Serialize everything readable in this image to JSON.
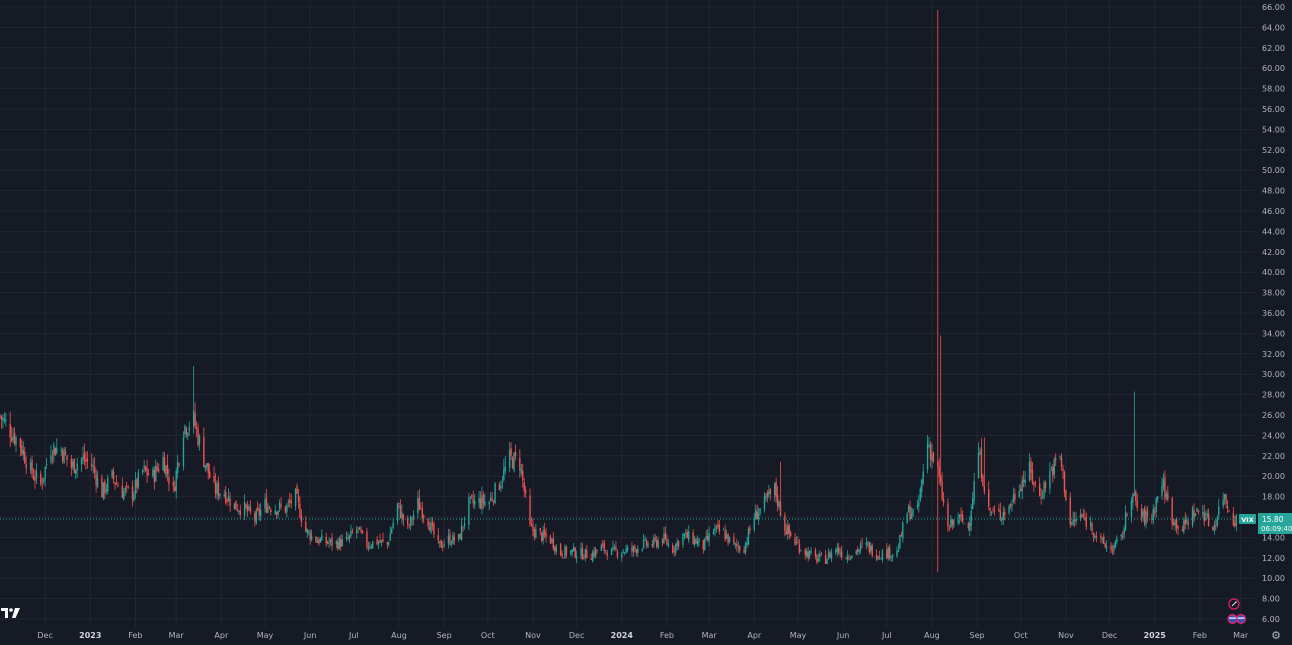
{
  "symbol": "VIX",
  "price_label": "15.80",
  "countdown": "06:09:40",
  "colors": {
    "background": "#161a25",
    "grid": "#232733",
    "up": "#26a69a",
    "down": "#ef5350",
    "price_line": "#26a69a",
    "axis_text": "#b2b5be"
  },
  "icons": {
    "logo": "tradingview-logo-icon",
    "settings": "gear-icon",
    "events": "event-flags-icon"
  },
  "chart_data": {
    "type": "candlestick",
    "y_axis": {
      "min": 5,
      "max": 66,
      "ticks": [
        "6.00",
        "8.00",
        "10.00",
        "12.00",
        "14.00",
        "16.00",
        "18.00",
        "20.00",
        "22.00",
        "24.00",
        "26.00",
        "28.00",
        "30.00",
        "32.00",
        "34.00",
        "36.00",
        "38.00",
        "40.00",
        "42.00",
        "44.00",
        "46.00",
        "48.00",
        "50.00",
        "52.00",
        "54.00",
        "56.00",
        "58.00",
        "60.00",
        "62.00",
        "64.00",
        "66.00"
      ]
    },
    "x_axis": {
      "start": "2022-10-31",
      "end": "2025-03-04",
      "ticks": [
        {
          "label": "Dec",
          "date": "2022-12-01"
        },
        {
          "label": "2023",
          "date": "2023-01-01",
          "bold": true
        },
        {
          "label": "Feb",
          "date": "2023-02-01"
        },
        {
          "label": "Mar",
          "date": "2023-03-01"
        },
        {
          "label": "Apr",
          "date": "2023-04-01"
        },
        {
          "label": "May",
          "date": "2023-05-01"
        },
        {
          "label": "Jun",
          "date": "2023-06-01"
        },
        {
          "label": "Jul",
          "date": "2023-07-01"
        },
        {
          "label": "Aug",
          "date": "2023-08-01"
        },
        {
          "label": "Sep",
          "date": "2023-09-01"
        },
        {
          "label": "Oct",
          "date": "2023-10-01"
        },
        {
          "label": "Nov",
          "date": "2023-11-01"
        },
        {
          "label": "Dec",
          "date": "2023-12-01"
        },
        {
          "label": "2024",
          "date": "2024-01-01",
          "bold": true
        },
        {
          "label": "Feb",
          "date": "2024-02-01"
        },
        {
          "label": "Mar",
          "date": "2024-03-01"
        },
        {
          "label": "Apr",
          "date": "2024-04-01"
        },
        {
          "label": "May",
          "date": "2024-05-01"
        },
        {
          "label": "Jun",
          "date": "2024-06-01"
        },
        {
          "label": "Jul",
          "date": "2024-07-01"
        },
        {
          "label": "Aug",
          "date": "2024-08-01"
        },
        {
          "label": "Sep",
          "date": "2024-09-01"
        },
        {
          "label": "Oct",
          "date": "2024-10-01"
        },
        {
          "label": "Nov",
          "date": "2024-11-01"
        },
        {
          "label": "Dec",
          "date": "2024-12-01"
        },
        {
          "label": "2025",
          "date": "2025-01-01",
          "bold": true
        },
        {
          "label": "Feb",
          "date": "2025-02-01"
        },
        {
          "label": "Mar",
          "date": "2025-03-01"
        }
      ]
    },
    "last_price": 15.8,
    "close_path": [
      [
        "2022-10-31",
        25.9
      ],
      [
        "2022-11-07",
        24.5
      ],
      [
        "2022-11-14",
        23.1
      ],
      [
        "2022-11-21",
        20.5
      ],
      [
        "2022-11-28",
        19.2
      ],
      [
        "2022-12-05",
        22.8
      ],
      [
        "2022-12-12",
        22.6
      ],
      [
        "2022-12-19",
        20.9
      ],
      [
        "2022-12-26",
        21.7
      ],
      [
        "2023-01-02",
        21.1
      ],
      [
        "2023-01-09",
        18.4
      ],
      [
        "2023-01-16",
        19.9
      ],
      [
        "2023-01-23",
        18.5
      ],
      [
        "2023-01-30",
        18.3
      ],
      [
        "2023-02-06",
        20.5
      ],
      [
        "2023-02-13",
        20.0
      ],
      [
        "2023-02-20",
        21.7
      ],
      [
        "2023-02-27",
        18.5
      ],
      [
        "2023-03-06",
        24.8
      ],
      [
        "2023-03-13",
        25.5
      ],
      [
        "2023-03-20",
        21.7
      ],
      [
        "2023-03-27",
        18.7
      ],
      [
        "2023-04-03",
        18.4
      ],
      [
        "2023-04-10",
        17.1
      ],
      [
        "2023-04-17",
        16.8
      ],
      [
        "2023-04-24",
        15.8
      ],
      [
        "2023-05-01",
        17.2
      ],
      [
        "2023-05-08",
        16.9
      ],
      [
        "2023-05-15",
        16.8
      ],
      [
        "2023-05-22",
        18.0
      ],
      [
        "2023-05-29",
        14.6
      ],
      [
        "2023-06-05",
        13.8
      ],
      [
        "2023-06-12",
        13.5
      ],
      [
        "2023-06-19",
        13.4
      ],
      [
        "2023-06-26",
        13.6
      ],
      [
        "2023-07-03",
        14.8
      ],
      [
        "2023-07-10",
        13.3
      ],
      [
        "2023-07-17",
        13.6
      ],
      [
        "2023-07-24",
        13.3
      ],
      [
        "2023-07-31",
        17.1
      ],
      [
        "2023-08-07",
        14.8
      ],
      [
        "2023-08-14",
        17.3
      ],
      [
        "2023-08-21",
        15.7
      ],
      [
        "2023-08-28",
        13.1
      ],
      [
        "2023-09-04",
        13.8
      ],
      [
        "2023-09-11",
        13.8
      ],
      [
        "2023-09-18",
        17.2
      ],
      [
        "2023-09-25",
        17.5
      ],
      [
        "2023-10-02",
        17.5
      ],
      [
        "2023-10-09",
        19.3
      ],
      [
        "2023-10-16",
        21.7
      ],
      [
        "2023-10-23",
        21.3
      ],
      [
        "2023-10-30",
        14.9
      ],
      [
        "2023-11-06",
        14.2
      ],
      [
        "2023-11-13",
        13.8
      ],
      [
        "2023-11-20",
        12.5
      ],
      [
        "2023-11-27",
        12.6
      ],
      [
        "2023-12-04",
        12.4
      ],
      [
        "2023-12-11",
        12.3
      ],
      [
        "2023-12-18",
        13.0
      ],
      [
        "2023-12-25",
        12.5
      ],
      [
        "2024-01-01",
        12.7
      ],
      [
        "2024-01-08",
        12.7
      ],
      [
        "2024-01-15",
        13.3
      ],
      [
        "2024-01-22",
        13.3
      ],
      [
        "2024-01-29",
        13.9
      ],
      [
        "2024-02-05",
        12.9
      ],
      [
        "2024-02-12",
        14.2
      ],
      [
        "2024-02-19",
        13.8
      ],
      [
        "2024-02-26",
        13.1
      ],
      [
        "2024-03-04",
        14.7
      ],
      [
        "2024-03-11",
        14.4
      ],
      [
        "2024-03-18",
        13.1
      ],
      [
        "2024-03-25",
        13.0
      ],
      [
        "2024-04-01",
        16.0
      ],
      [
        "2024-04-08",
        17.3
      ],
      [
        "2024-04-15",
        18.7
      ],
      [
        "2024-04-22",
        15.0
      ],
      [
        "2024-04-29",
        13.5
      ],
      [
        "2024-05-06",
        12.6
      ],
      [
        "2024-05-13",
        11.9
      ],
      [
        "2024-05-20",
        11.9
      ],
      [
        "2024-05-27",
        12.9
      ],
      [
        "2024-06-03",
        12.2
      ],
      [
        "2024-06-10",
        12.7
      ],
      [
        "2024-06-17",
        13.2
      ],
      [
        "2024-06-24",
        12.4
      ],
      [
        "2024-07-01",
        12.5
      ],
      [
        "2024-07-08",
        12.5
      ],
      [
        "2024-07-15",
        16.5
      ],
      [
        "2024-07-22",
        16.4
      ],
      [
        "2024-07-29",
        23.4
      ],
      [
        "2024-08-05",
        20.4
      ],
      [
        "2024-08-12",
        14.8
      ],
      [
        "2024-08-19",
        15.9
      ],
      [
        "2024-08-26",
        15.0
      ],
      [
        "2024-09-02",
        22.4
      ],
      [
        "2024-09-09",
        16.6
      ],
      [
        "2024-09-16",
        16.2
      ],
      [
        "2024-09-23",
        16.9
      ],
      [
        "2024-09-30",
        19.2
      ],
      [
        "2024-10-07",
        20.5
      ],
      [
        "2024-10-14",
        18.0
      ],
      [
        "2024-10-21",
        20.3
      ],
      [
        "2024-10-28",
        21.9
      ],
      [
        "2024-11-04",
        15.2
      ],
      [
        "2024-11-11",
        16.1
      ],
      [
        "2024-11-18",
        15.2
      ],
      [
        "2024-11-25",
        13.5
      ],
      [
        "2024-12-02",
        12.8
      ],
      [
        "2024-12-09",
        13.8
      ],
      [
        "2024-12-16",
        18.4
      ],
      [
        "2024-12-23",
        15.9
      ],
      [
        "2024-12-30",
        16.1
      ],
      [
        "2025-01-06",
        19.5
      ],
      [
        "2025-01-13",
        15.9
      ],
      [
        "2025-01-20",
        14.8
      ],
      [
        "2025-01-27",
        16.4
      ],
      [
        "2025-02-03",
        16.5
      ],
      [
        "2025-02-10",
        14.8
      ],
      [
        "2025-02-17",
        18.2
      ],
      [
        "2025-02-24",
        15.8
      ]
    ],
    "spikes": [
      {
        "date": "2023-03-13",
        "high": 30.8
      },
      {
        "date": "2023-10-20",
        "high": 23.1
      },
      {
        "date": "2024-04-19",
        "high": 21.4
      },
      {
        "date": "2024-08-05",
        "high": 65.7
      },
      {
        "date": "2024-08-07",
        "high": 33.8
      },
      {
        "date": "2024-09-06",
        "high": 23.8
      },
      {
        "date": "2024-12-18",
        "high": 28.3
      }
    ]
  }
}
